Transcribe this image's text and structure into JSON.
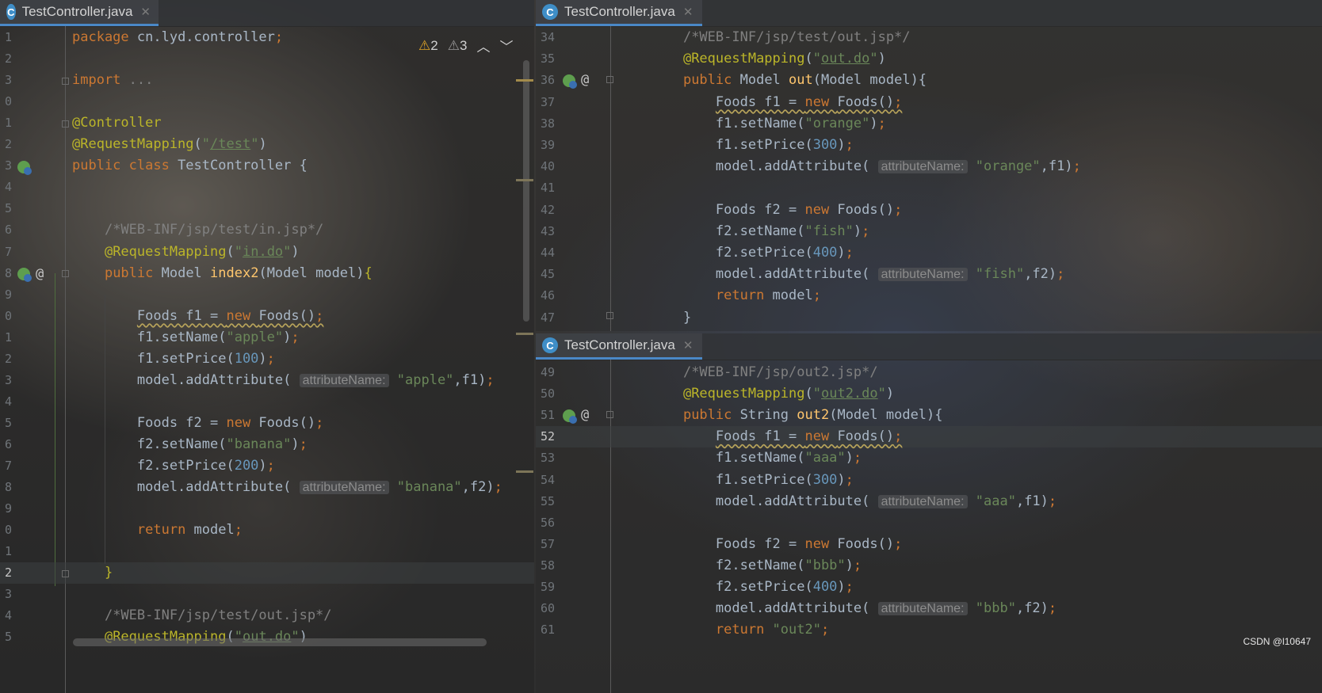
{
  "panes": {
    "left": {
      "tab": "TestController.java",
      "warnings": {
        "errors": "2",
        "weak": "3"
      },
      "lines": [
        {
          "n": "1",
          "parts": [
            [
              "kw",
              "package "
            ],
            [
              "code",
              "cn.lyd.controller"
            ],
            [
              "kw",
              ";"
            ]
          ]
        },
        {
          "n": "2",
          "parts": []
        },
        {
          "n": "3",
          "parts": [
            [
              "kw",
              "import "
            ],
            [
              "cm",
              "..."
            ]
          ]
        },
        {
          "n": "0",
          "parts": []
        },
        {
          "n": "1",
          "parts": [
            [
              "an",
              "@Controller"
            ]
          ]
        },
        {
          "n": "2",
          "parts": [
            [
              "an",
              "@RequestMapping"
            ],
            [
              "code",
              "("
            ],
            [
              "str",
              "\""
            ],
            [
              "strlink",
              "/test"
            ],
            [
              "str",
              "\""
            ],
            [
              "code",
              ")"
            ]
          ]
        },
        {
          "n": "3",
          "parts": [
            [
              "kw",
              "public class "
            ],
            [
              "code",
              "TestController {"
            ]
          ]
        },
        {
          "n": "4",
          "parts": []
        },
        {
          "n": "5",
          "parts": []
        },
        {
          "n": "6",
          "parts": [
            [
              "code",
              "    "
            ],
            [
              "cm",
              "/*WEB-INF/jsp/test/in.jsp*/"
            ]
          ]
        },
        {
          "n": "7",
          "parts": [
            [
              "code",
              "    "
            ],
            [
              "an",
              "@RequestMapping"
            ],
            [
              "code",
              "("
            ],
            [
              "str",
              "\""
            ],
            [
              "strlink",
              "in.do"
            ],
            [
              "str",
              "\""
            ],
            [
              "code",
              ")"
            ]
          ]
        },
        {
          "n": "8",
          "parts": [
            [
              "code",
              "    "
            ],
            [
              "kw",
              "public "
            ],
            [
              "code",
              "Model "
            ],
            [
              "fn",
              "index2"
            ],
            [
              "code",
              "(Model model)"
            ],
            [
              "an",
              "{"
            ]
          ]
        },
        {
          "n": "9",
          "parts": []
        },
        {
          "n": "0",
          "parts": [
            [
              "code",
              "        "
            ],
            [
              "squig",
              "Foods f1 = "
            ],
            [
              "kwsq",
              "new "
            ],
            [
              "squig",
              "Foods()"
            ],
            [
              "kwsq",
              ";"
            ]
          ]
        },
        {
          "n": "1",
          "parts": [
            [
              "code",
              "        f1.setName("
            ],
            [
              "str",
              "\"apple\""
            ],
            [
              "code",
              ")"
            ],
            [
              "kw",
              ";"
            ]
          ]
        },
        {
          "n": "2",
          "parts": [
            [
              "code",
              "        f1.setPrice("
            ],
            [
              "num",
              "100"
            ],
            [
              "code",
              ")"
            ],
            [
              "kw",
              ";"
            ]
          ]
        },
        {
          "n": "3",
          "parts": [
            [
              "code",
              "        model.addAttribute( "
            ],
            [
              "hint",
              "attributeName:"
            ],
            [
              "code",
              " "
            ],
            [
              "str",
              "\"apple\""
            ],
            [
              "code",
              ",f1)"
            ],
            [
              "kw",
              ";"
            ]
          ]
        },
        {
          "n": "4",
          "parts": []
        },
        {
          "n": "5",
          "parts": [
            [
              "code",
              "        Foods f2 = "
            ],
            [
              "kw",
              "new "
            ],
            [
              "code",
              "Foods()"
            ],
            [
              "kw",
              ";"
            ]
          ]
        },
        {
          "n": "6",
          "parts": [
            [
              "code",
              "        f2.setName("
            ],
            [
              "str",
              "\"banana\""
            ],
            [
              "code",
              ")"
            ],
            [
              "kw",
              ";"
            ]
          ]
        },
        {
          "n": "7",
          "parts": [
            [
              "code",
              "        f2.setPrice("
            ],
            [
              "num",
              "200"
            ],
            [
              "code",
              ")"
            ],
            [
              "kw",
              ";"
            ]
          ]
        },
        {
          "n": "8",
          "parts": [
            [
              "code",
              "        model.addAttribute( "
            ],
            [
              "hint",
              "attributeName:"
            ],
            [
              "code",
              " "
            ],
            [
              "str",
              "\"banana\""
            ],
            [
              "code",
              ",f2)"
            ],
            [
              "kw",
              ";"
            ]
          ]
        },
        {
          "n": "9",
          "parts": []
        },
        {
          "n": "0",
          "parts": [
            [
              "code",
              "        "
            ],
            [
              "kw",
              "return "
            ],
            [
              "code",
              "model"
            ],
            [
              "kw",
              ";"
            ]
          ]
        },
        {
          "n": "1",
          "parts": []
        },
        {
          "n": "2",
          "parts": [
            [
              "code",
              "    "
            ],
            [
              "an",
              "}"
            ]
          ],
          "current": true
        },
        {
          "n": "3",
          "parts": []
        },
        {
          "n": "4",
          "parts": [
            [
              "code",
              "    "
            ],
            [
              "cm",
              "/*WEB-INF/jsp/test/out.jsp*/"
            ]
          ]
        },
        {
          "n": "5",
          "parts": [
            [
              "code",
              "    "
            ],
            [
              "an",
              "@RequestMapping"
            ],
            [
              "code",
              "("
            ],
            [
              "str",
              "\""
            ],
            [
              "strlink",
              "out.do"
            ],
            [
              "str",
              "\""
            ],
            [
              "code",
              ")"
            ]
          ]
        }
      ]
    },
    "topright": {
      "tab": "TestController.java",
      "lines": [
        {
          "n": "34",
          "parts": [
            [
              "code",
              "    "
            ],
            [
              "cm",
              "/*WEB-INF/jsp/test/out.jsp*/"
            ]
          ]
        },
        {
          "n": "35",
          "parts": [
            [
              "code",
              "    "
            ],
            [
              "an",
              "@RequestMapping"
            ],
            [
              "code",
              "("
            ],
            [
              "str",
              "\""
            ],
            [
              "strlink",
              "out.do"
            ],
            [
              "str",
              "\""
            ],
            [
              "code",
              ")"
            ]
          ]
        },
        {
          "n": "36",
          "parts": [
            [
              "code",
              "    "
            ],
            [
              "kw",
              "public "
            ],
            [
              "code",
              "Model "
            ],
            [
              "fn",
              "out"
            ],
            [
              "code",
              "(Model model){"
            ]
          ]
        },
        {
          "n": "37",
          "parts": [
            [
              "code",
              "        "
            ],
            [
              "squig",
              "Foods f1 = "
            ],
            [
              "kwsq",
              "new "
            ],
            [
              "squig",
              "Foods()"
            ],
            [
              "kwsq",
              ";"
            ]
          ]
        },
        {
          "n": "38",
          "parts": [
            [
              "code",
              "        f1.setName("
            ],
            [
              "str",
              "\"orange\""
            ],
            [
              "code",
              ")"
            ],
            [
              "kw",
              ";"
            ]
          ]
        },
        {
          "n": "39",
          "parts": [
            [
              "code",
              "        f1.setPrice("
            ],
            [
              "num",
              "300"
            ],
            [
              "code",
              ")"
            ],
            [
              "kw",
              ";"
            ]
          ]
        },
        {
          "n": "40",
          "parts": [
            [
              "code",
              "        model.addAttribute( "
            ],
            [
              "hint",
              "attributeName:"
            ],
            [
              "code",
              " "
            ],
            [
              "str",
              "\"orange\""
            ],
            [
              "code",
              ",f1)"
            ],
            [
              "kw",
              ";"
            ]
          ]
        },
        {
          "n": "41",
          "parts": []
        },
        {
          "n": "42",
          "parts": [
            [
              "code",
              "        Foods f2 = "
            ],
            [
              "kw",
              "new "
            ],
            [
              "code",
              "Foods()"
            ],
            [
              "kw",
              ";"
            ]
          ]
        },
        {
          "n": "43",
          "parts": [
            [
              "code",
              "        f2.setName("
            ],
            [
              "str",
              "\"fish\""
            ],
            [
              "code",
              ")"
            ],
            [
              "kw",
              ";"
            ]
          ]
        },
        {
          "n": "44",
          "parts": [
            [
              "code",
              "        f2.setPrice("
            ],
            [
              "num",
              "400"
            ],
            [
              "code",
              ")"
            ],
            [
              "kw",
              ";"
            ]
          ]
        },
        {
          "n": "45",
          "parts": [
            [
              "code",
              "        model.addAttribute( "
            ],
            [
              "hint",
              "attributeName:"
            ],
            [
              "code",
              " "
            ],
            [
              "str",
              "\"fish\""
            ],
            [
              "code",
              ",f2)"
            ],
            [
              "kw",
              ";"
            ]
          ]
        },
        {
          "n": "46",
          "parts": [
            [
              "code",
              "        "
            ],
            [
              "kw",
              "return "
            ],
            [
              "code",
              "model"
            ],
            [
              "kw",
              ";"
            ]
          ]
        },
        {
          "n": "47",
          "parts": [
            [
              "code",
              "    }"
            ]
          ]
        }
      ]
    },
    "bottomright": {
      "tab": "TestController.java",
      "lines": [
        {
          "n": "49",
          "parts": [
            [
              "code",
              "    "
            ],
            [
              "cm",
              "/*WEB-INF/jsp/out2.jsp*/"
            ]
          ]
        },
        {
          "n": "50",
          "parts": [
            [
              "code",
              "    "
            ],
            [
              "an",
              "@RequestMapping"
            ],
            [
              "code",
              "("
            ],
            [
              "str",
              "\""
            ],
            [
              "strlink",
              "out2.do"
            ],
            [
              "str",
              "\""
            ],
            [
              "code",
              ")"
            ]
          ]
        },
        {
          "n": "51",
          "parts": [
            [
              "code",
              "    "
            ],
            [
              "kw",
              "public "
            ],
            [
              "code",
              "String "
            ],
            [
              "fn",
              "out2"
            ],
            [
              "code",
              "(Model model){"
            ]
          ]
        },
        {
          "n": "52",
          "parts": [
            [
              "code",
              "        "
            ],
            [
              "squig",
              "Foods f1 = "
            ],
            [
              "kwsq",
              "new "
            ],
            [
              "squig",
              "Foods()"
            ],
            [
              "kwsq",
              ";"
            ]
          ],
          "current": true
        },
        {
          "n": "53",
          "parts": [
            [
              "code",
              "        f1.setName("
            ],
            [
              "str",
              "\"aaa\""
            ],
            [
              "code",
              ")"
            ],
            [
              "kw",
              ";"
            ]
          ]
        },
        {
          "n": "54",
          "parts": [
            [
              "code",
              "        f1.setPrice("
            ],
            [
              "num",
              "300"
            ],
            [
              "code",
              ")"
            ],
            [
              "kw",
              ";"
            ]
          ]
        },
        {
          "n": "55",
          "parts": [
            [
              "code",
              "        model.addAttribute( "
            ],
            [
              "hint",
              "attributeName:"
            ],
            [
              "code",
              " "
            ],
            [
              "str",
              "\"aaa\""
            ],
            [
              "code",
              ",f1)"
            ],
            [
              "kw",
              ";"
            ]
          ]
        },
        {
          "n": "56",
          "parts": []
        },
        {
          "n": "57",
          "parts": [
            [
              "code",
              "        Foods f2 = "
            ],
            [
              "kw",
              "new "
            ],
            [
              "code",
              "Foods()"
            ],
            [
              "kw",
              ";"
            ]
          ]
        },
        {
          "n": "58",
          "parts": [
            [
              "code",
              "        f2.setName("
            ],
            [
              "str",
              "\"bbb\""
            ],
            [
              "code",
              ")"
            ],
            [
              "kw",
              ";"
            ]
          ]
        },
        {
          "n": "59",
          "parts": [
            [
              "code",
              "        f2.setPrice("
            ],
            [
              "num",
              "400"
            ],
            [
              "code",
              ")"
            ],
            [
              "kw",
              ";"
            ]
          ]
        },
        {
          "n": "60",
          "parts": [
            [
              "code",
              "        model.addAttribute( "
            ],
            [
              "hint",
              "attributeName:"
            ],
            [
              "code",
              " "
            ],
            [
              "str",
              "\"bbb\""
            ],
            [
              "code",
              ",f2)"
            ],
            [
              "kw",
              ";"
            ]
          ]
        },
        {
          "n": "61",
          "parts": [
            [
              "code",
              "        "
            ],
            [
              "kw",
              "return "
            ],
            [
              "str",
              "\"out2\""
            ],
            [
              "kw",
              ";"
            ]
          ]
        }
      ]
    }
  },
  "watermark": "CSDN @l10647",
  "colors": {
    "keyword": "#cc7832",
    "string": "#6a8759",
    "comment": "#808080",
    "annotation": "#bbb529",
    "number": "#6897bb",
    "method": "#ffc66d",
    "plain": "#a9b7c6"
  },
  "icons": {
    "class_tab": "C",
    "warning": "warning-triangle-icon",
    "nav_up": "chevron-up-icon",
    "nav_down": "chevron-down-icon",
    "gutter_impl": "spring-bean-icon",
    "gutter_at": "@"
  }
}
